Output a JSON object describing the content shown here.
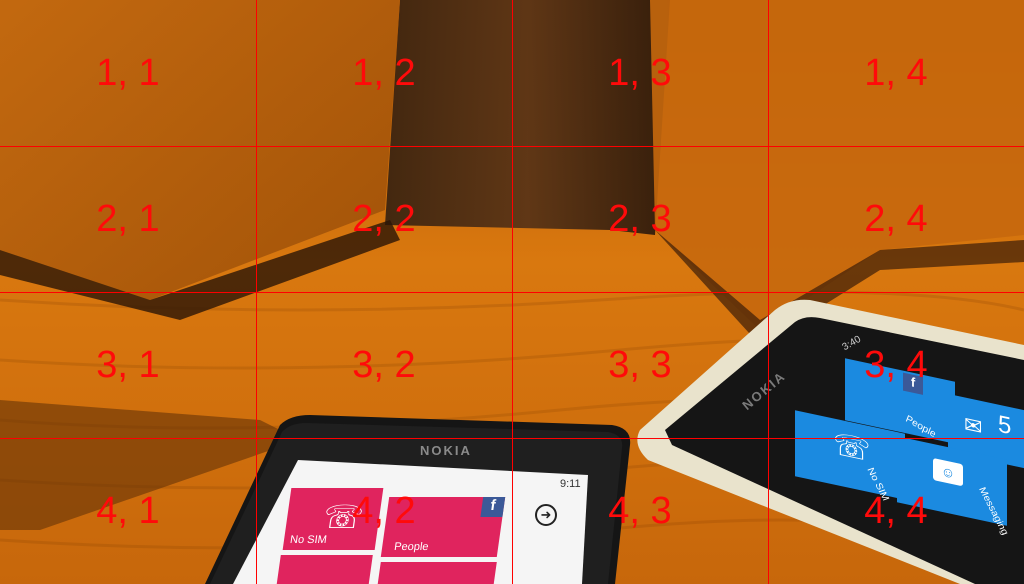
{
  "grid": {
    "rows": 4,
    "cols": 4,
    "line_color": "#ff0000",
    "label_color": "#ff0a0a",
    "labels": [
      [
        "1, 1",
        "1, 2",
        "1, 3",
        "1, 4"
      ],
      [
        "2, 1",
        "2, 2",
        "2, 3",
        "2, 4"
      ],
      [
        "3, 1",
        "3, 2",
        "3, 3",
        "3, 4"
      ],
      [
        "4, 1",
        "4, 2",
        "4, 3",
        "4, 4"
      ]
    ]
  },
  "phone_front": {
    "brand": "NOKIA",
    "time": "9:11",
    "tiles": {
      "phone": "No SIM",
      "people": "People"
    },
    "tile_color": "#e0245e"
  },
  "phone_right": {
    "brand": "NOKIA",
    "status": "3:40",
    "tiles": {
      "people": "People",
      "phone": "No SIM",
      "messaging": "Messaging",
      "mail_count": "5"
    },
    "tile_color": "#1b8ae0"
  },
  "colors": {
    "table": "#c96a0c",
    "accent_pink": "#e0245e",
    "accent_blue": "#1b8ae0"
  }
}
